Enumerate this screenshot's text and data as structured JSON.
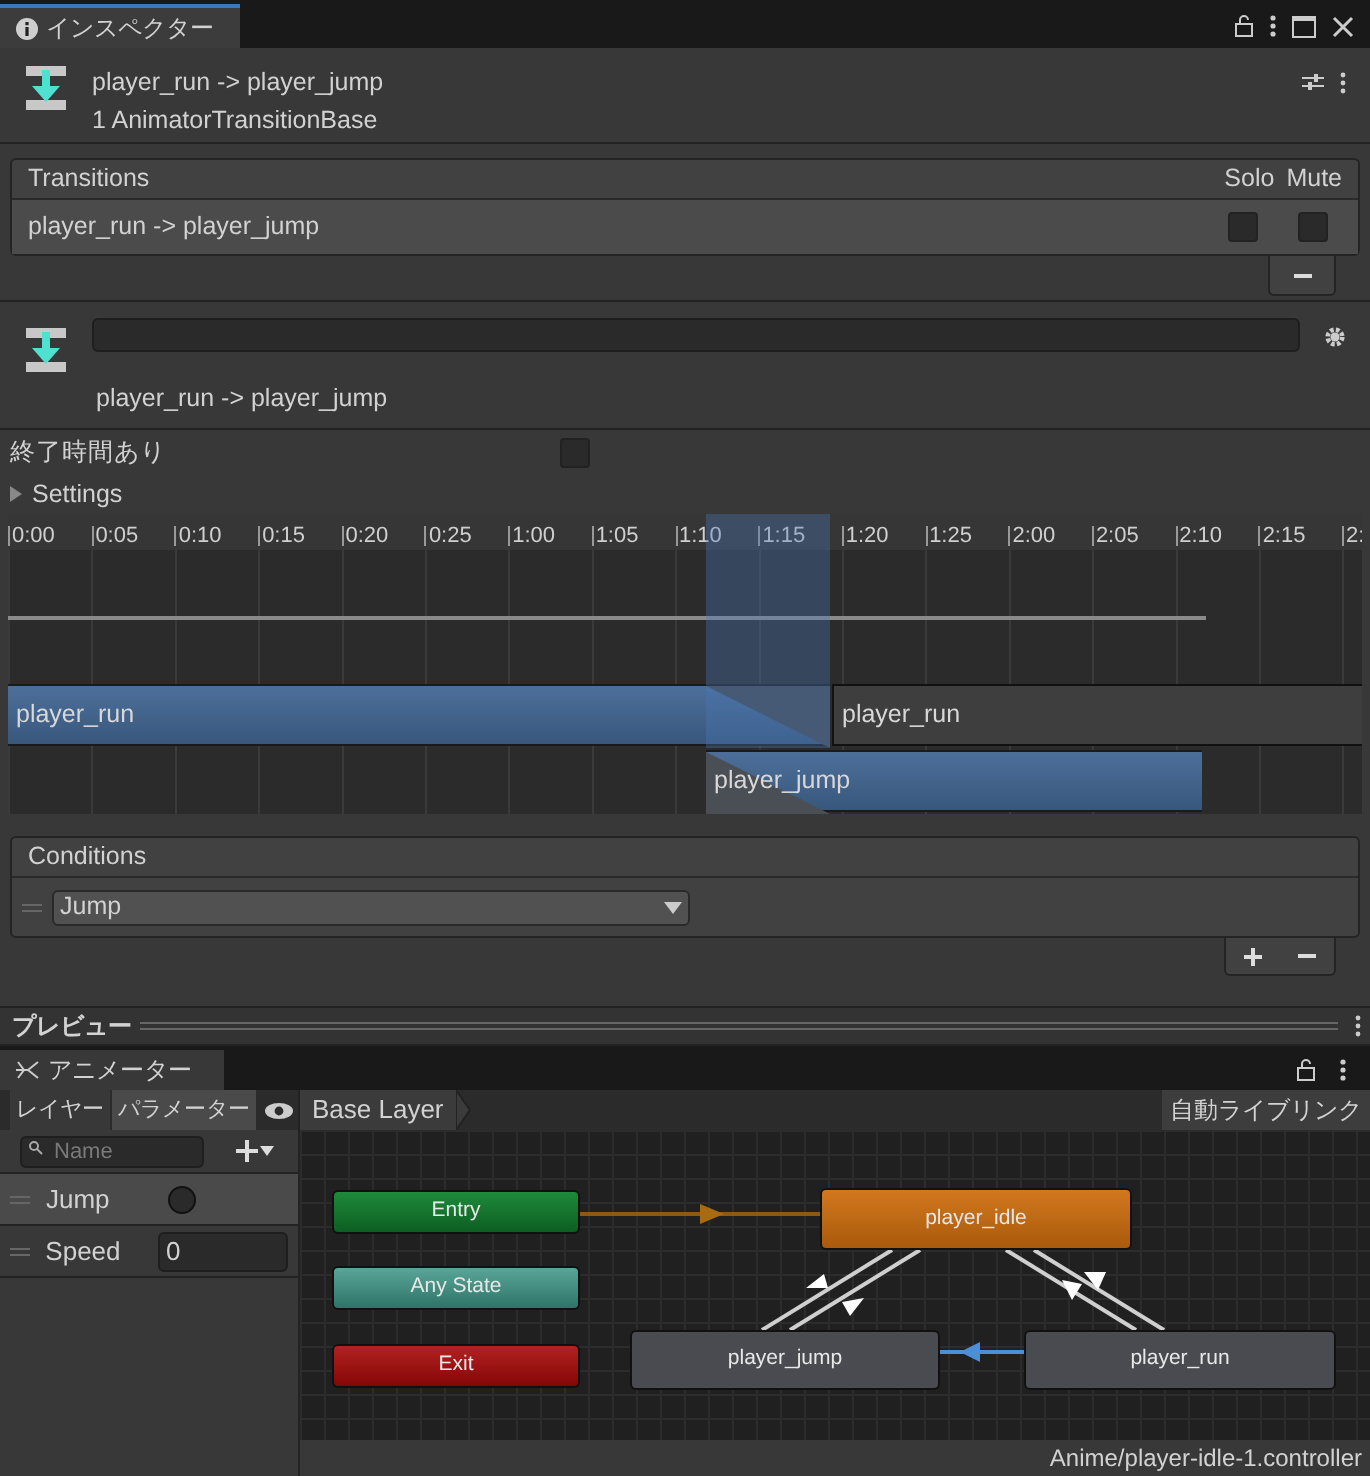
{
  "inspector": {
    "tab": "インスペクター",
    "title": "player_run -> player_jump",
    "subtitle": "1 AnimatorTransitionBase",
    "transitions": {
      "header": "Transitions",
      "solo_label": "Solo",
      "mute_label": "Mute",
      "rows": [
        {
          "name": "player_run -> player_jump",
          "solo": false,
          "mute": false
        }
      ]
    },
    "transition": {
      "name": "player_run -> player_jump"
    },
    "has_exit_time": {
      "label": "終了時間あり",
      "checked": false
    },
    "settings": {
      "label": "Settings",
      "expanded": false
    },
    "timeline": {
      "ticks": [
        "0:00",
        "0:05",
        "0:10",
        "0:15",
        "0:20",
        "0:25",
        "1:00",
        "1:05",
        "1:10",
        "1:15",
        "1:20",
        "1:25",
        "2:00",
        "2:05",
        "2:10",
        "2:15",
        "2:"
      ],
      "clips": [
        {
          "label": "player_run",
          "kind": "source"
        },
        {
          "label": "player_run",
          "kind": "rest"
        },
        {
          "label": "player_jump",
          "kind": "target"
        }
      ]
    },
    "conditions": {
      "header": "Conditions",
      "items": [
        {
          "parameter": "Jump"
        }
      ]
    },
    "preview": "プレビュー"
  },
  "animator": {
    "tab": "アニメーター",
    "side_tabs": [
      {
        "label": "レイヤー",
        "selected": false
      },
      {
        "label": "パラメーター",
        "selected": true
      }
    ],
    "layer": "Base Layer",
    "live_link": "自動ライブリンク",
    "search": {
      "placeholder": "Name"
    },
    "parameters": [
      {
        "name": "Jump",
        "kind": "trigger",
        "selected": true
      },
      {
        "name": "Speed",
        "kind": "float",
        "value": "0",
        "selected": false
      }
    ],
    "nodes": [
      {
        "label": "Entry",
        "kind": "entry"
      },
      {
        "label": "Any State",
        "kind": "any"
      },
      {
        "label": "Exit",
        "kind": "exit"
      },
      {
        "label": "player_idle",
        "kind": "default"
      },
      {
        "label": "player_jump",
        "kind": "state"
      },
      {
        "label": "player_run",
        "kind": "state"
      }
    ],
    "status": "Anime/player-idle-1.controller"
  }
}
